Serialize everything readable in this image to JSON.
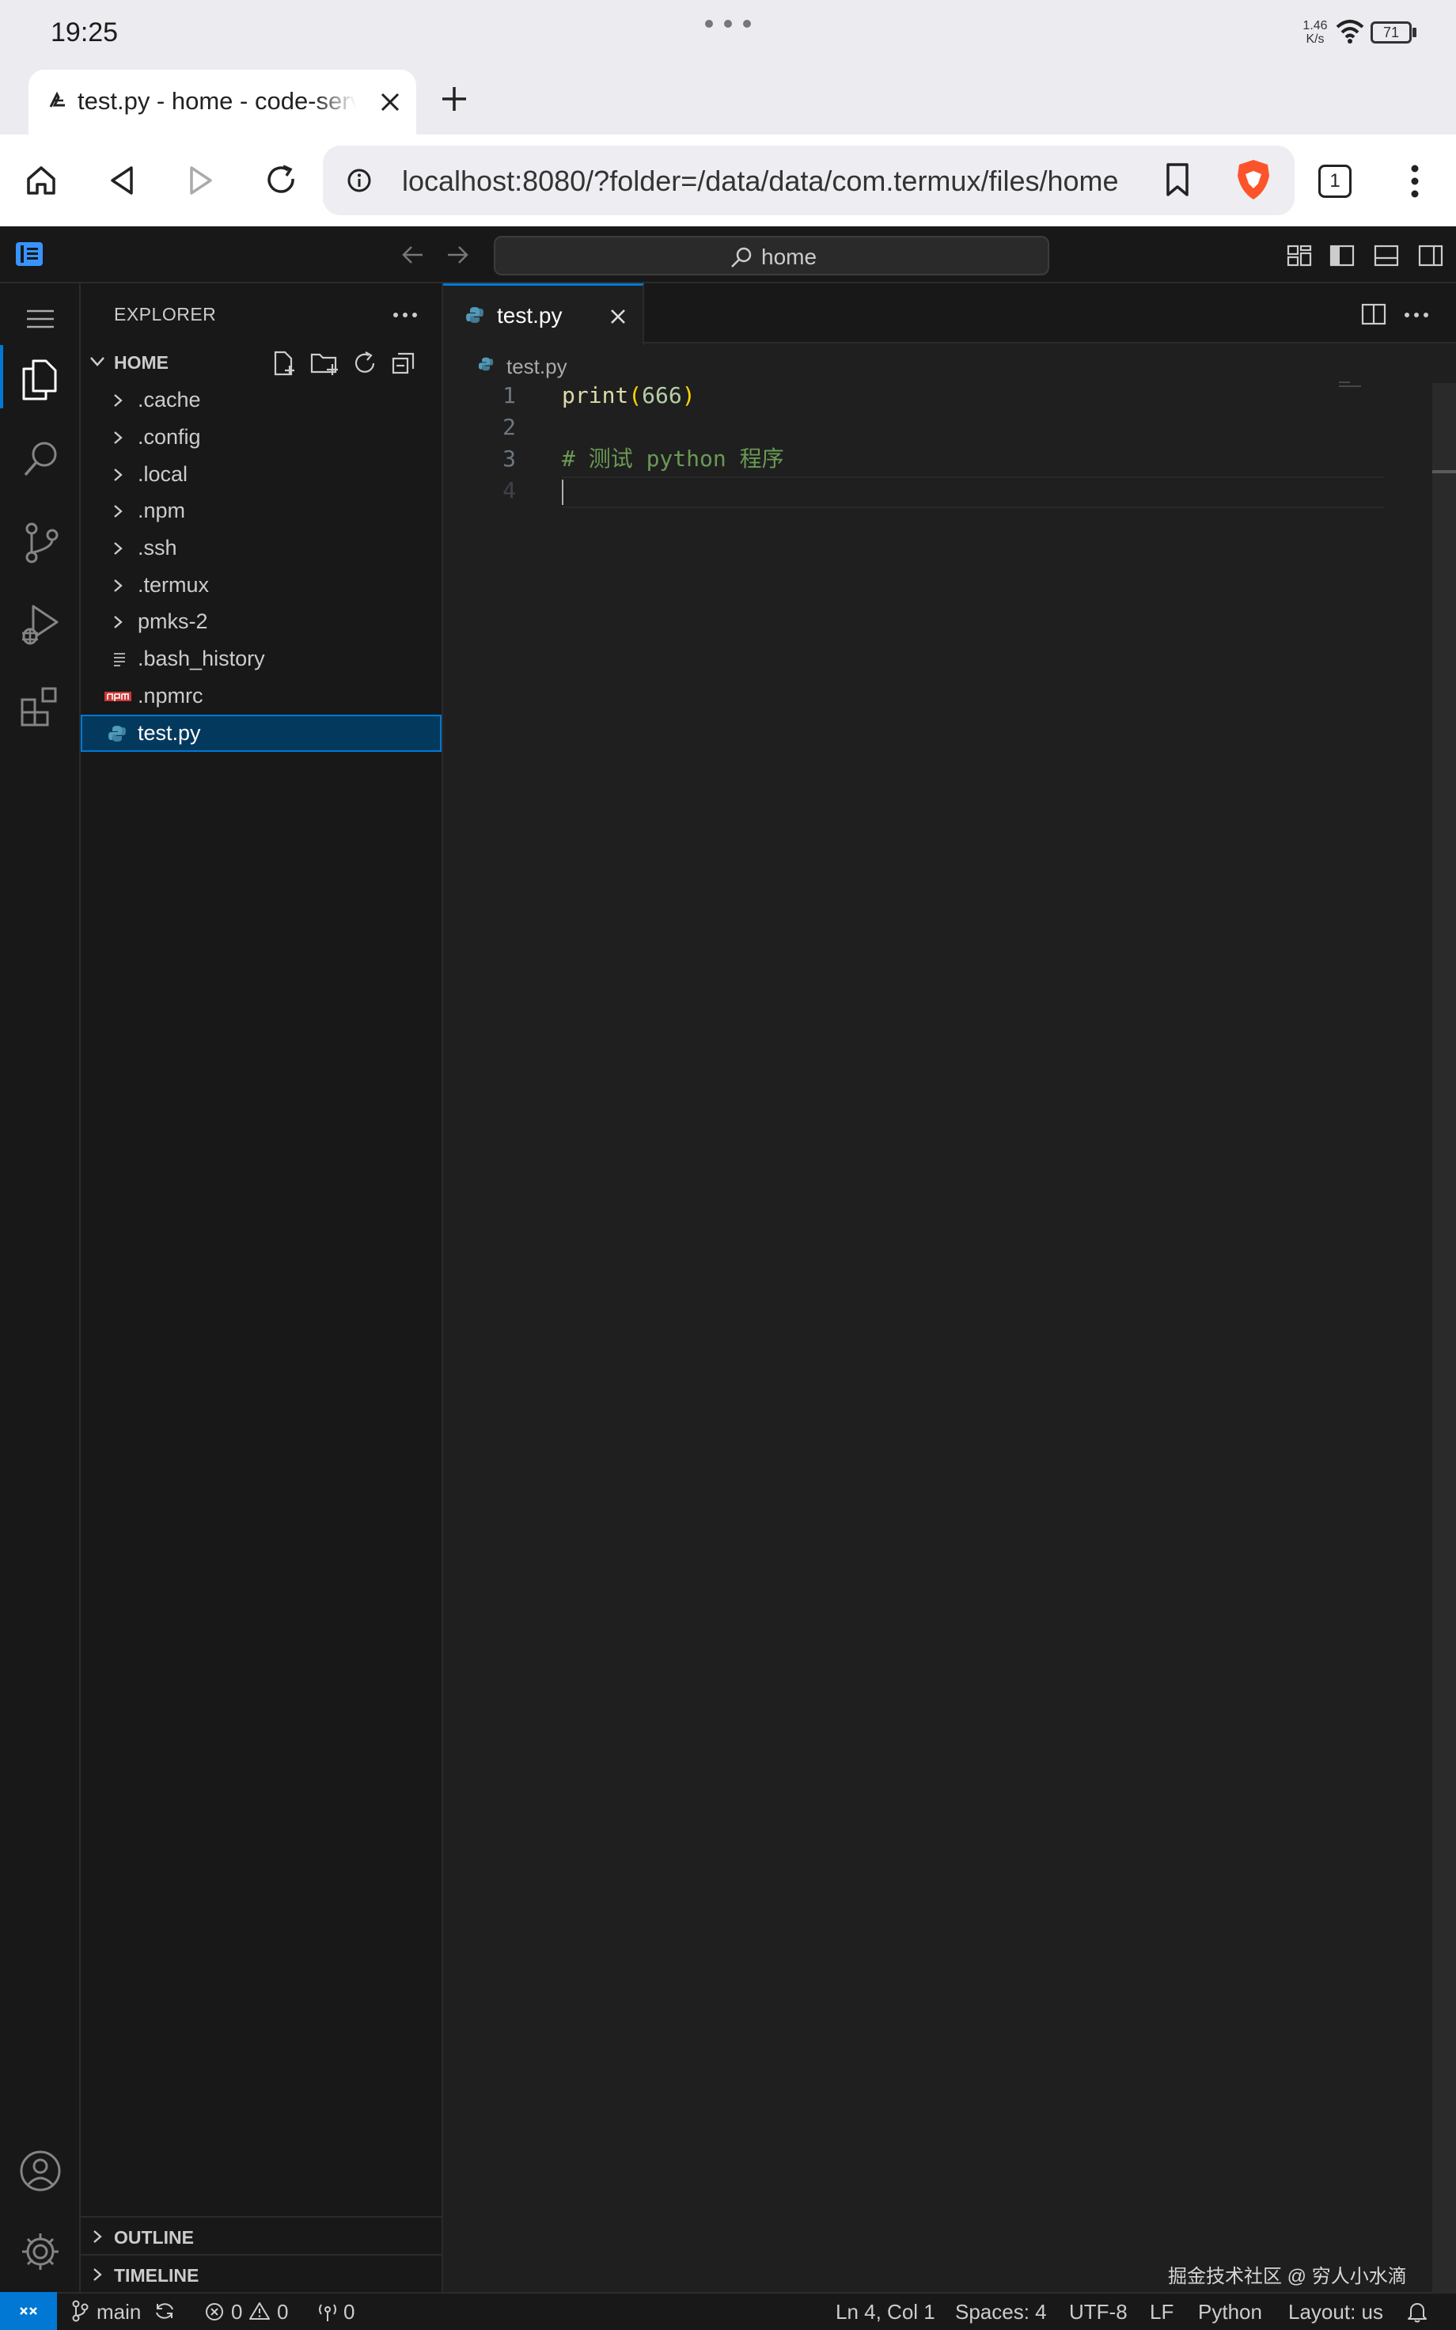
{
  "device": {
    "time": "19:25",
    "net_speed_top": "1.46",
    "net_speed_bottom": "K/s",
    "battery": "71"
  },
  "browser": {
    "tab_title": "test.py - home - code-server",
    "url": "localhost:8080/?folder=/data/data/com.termux/files/home",
    "tab_count": "1"
  },
  "titlebar": {
    "search_label": "home"
  },
  "explorer": {
    "title": "EXPLORER",
    "section": "HOME",
    "items": [
      {
        "label": ".cache",
        "kind": "folder"
      },
      {
        "label": ".config",
        "kind": "folder"
      },
      {
        "label": ".local",
        "kind": "folder"
      },
      {
        "label": ".npm",
        "kind": "folder"
      },
      {
        "label": ".ssh",
        "kind": "folder"
      },
      {
        "label": ".termux",
        "kind": "folder"
      },
      {
        "label": "pmks-2",
        "kind": "folder"
      },
      {
        "label": ".bash_history",
        "kind": "file"
      },
      {
        "label": ".npmrc",
        "kind": "npm"
      },
      {
        "label": "test.py",
        "kind": "python",
        "selected": true
      }
    ],
    "outline": "OUTLINE",
    "timeline": "TIMELINE"
  },
  "editor": {
    "tab_label": "test.py",
    "breadcrumb": "test.py",
    "lines": [
      {
        "num": "1",
        "fn": "print",
        "open": "(",
        "arg": "666",
        "close": ")",
        "comment": ""
      },
      {
        "num": "2",
        "fn": "",
        "open": "",
        "arg": "",
        "close": "",
        "comment": ""
      },
      {
        "num": "3",
        "fn": "",
        "open": "",
        "arg": "",
        "close": "",
        "comment": "# 测试 python 程序"
      },
      {
        "num": "4",
        "fn": "",
        "open": "",
        "arg": "",
        "close": "",
        "comment": ""
      }
    ]
  },
  "statusbar": {
    "branch": "main",
    "errors": "0",
    "warnings": "0",
    "ports": "0",
    "position": "Ln 4, Col 1",
    "spaces": "Spaces: 4",
    "encoding": "UTF-8",
    "eol": "LF",
    "language": "Python",
    "layout": "Layout: us"
  },
  "watermark": "掘金技术社区 @ 穷人小水滴",
  "colors": {
    "accent": "#0078d4",
    "keyword_fn": "#dcdcaa",
    "bracket": "#ffd700",
    "number": "#b5cea8",
    "comment": "#6a9955",
    "python": "#519aba",
    "brave": "#fb542b"
  }
}
